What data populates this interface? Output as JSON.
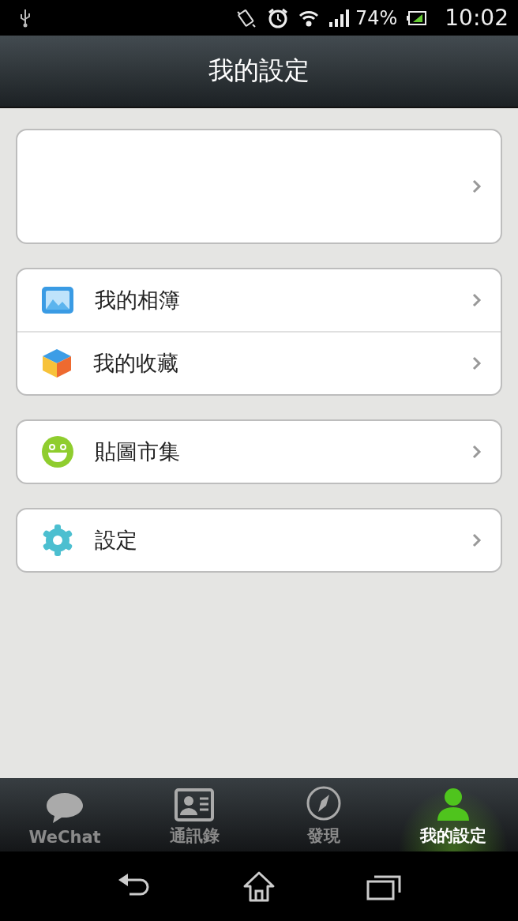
{
  "status_bar": {
    "battery": "74%",
    "time": "10:02"
  },
  "header": {
    "title": "我的設定"
  },
  "groups": [
    {
      "items": [
        {
          "kind": "album",
          "label": "我的相簿"
        },
        {
          "kind": "favorites",
          "label": "我的收藏"
        }
      ]
    },
    {
      "items": [
        {
          "kind": "stickers",
          "label": "貼圖市集"
        }
      ]
    },
    {
      "items": [
        {
          "kind": "settings",
          "label": "設定"
        }
      ]
    }
  ],
  "tabs": [
    {
      "kind": "chats",
      "label": "WeChat",
      "selected": false
    },
    {
      "kind": "contacts",
      "label": "通訊錄",
      "selected": false
    },
    {
      "kind": "discover",
      "label": "發現",
      "selected": false
    },
    {
      "kind": "me",
      "label": "我的設定",
      "selected": true
    }
  ]
}
